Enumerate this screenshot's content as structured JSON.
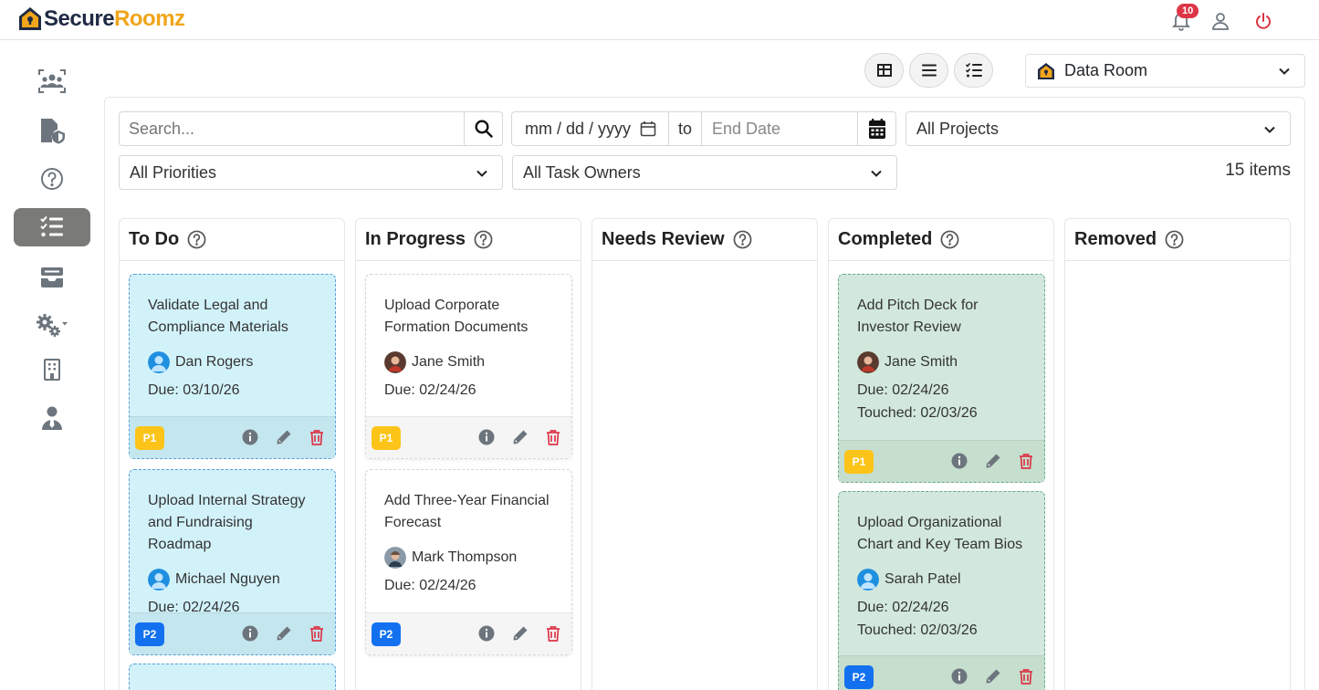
{
  "app": {
    "logo_part1": "Secure",
    "logo_part2": "Roomz",
    "notification_count": "10"
  },
  "toolbar": {
    "room_label": "Data Room"
  },
  "filters": {
    "search_placeholder": "Search...",
    "start_date": "mm / dd / yyyy",
    "to_label": "to",
    "end_placeholder": "End Date",
    "projects": "All Projects",
    "priorities": "All Priorities",
    "owners": "All Task Owners",
    "items_count": "15 items"
  },
  "columns": [
    {
      "title": "To Do"
    },
    {
      "title": "In Progress"
    },
    {
      "title": "Needs Review"
    },
    {
      "title": "Completed"
    },
    {
      "title": "Removed"
    }
  ],
  "cards": {
    "todo": [
      {
        "title": "Validate Legal and Compliance Materials",
        "owner": "Dan Rogers",
        "due": "Due: 03/10/26",
        "priority": "P1"
      },
      {
        "title": "Upload Internal Strategy and Fundraising Roadmap",
        "owner": "Michael Nguyen",
        "due": "Due: 02/24/26",
        "priority": "P2"
      }
    ],
    "progress": [
      {
        "title": "Upload Corporate Formation Documents",
        "owner": "Jane Smith",
        "due": "Due: 02/24/26",
        "priority": "P1"
      },
      {
        "title": "Add Three-Year Financial Forecast",
        "owner": "Mark Thompson",
        "due": "Due: 02/24/26",
        "priority": "P2"
      }
    ],
    "completed": [
      {
        "title": "Add Pitch Deck for Investor Review",
        "owner": "Jane Smith",
        "due": "Due: 02/24/26",
        "touched": "Touched: 02/03/26",
        "priority": "P1"
      },
      {
        "title": "Upload Organizational Chart and Key Team Bios",
        "owner": "Sarah Patel",
        "due": "Due: 02/24/26",
        "touched": "Touched: 02/03/26",
        "priority": "P2"
      }
    ]
  },
  "colors": {
    "brand_dark": "#1f2a44",
    "brand_accent": "#f0a51a",
    "todo_card": "#d2f2fa",
    "completed_card": "#d2e8dd",
    "p1": "#fcc419",
    "p2": "#1371f0",
    "danger": "#dc3545"
  },
  "icons": {
    "sidebar": [
      "team-icon",
      "file-shield-icon",
      "help-icon",
      "tasks-icon",
      "inbox-icon",
      "settings-icon",
      "building-icon",
      "user-tie-icon"
    ],
    "top": [
      "bell-icon",
      "user-icon",
      "power-icon"
    ],
    "views": [
      "grid-view-icon",
      "list-view-icon",
      "checklist-view-icon"
    ]
  }
}
